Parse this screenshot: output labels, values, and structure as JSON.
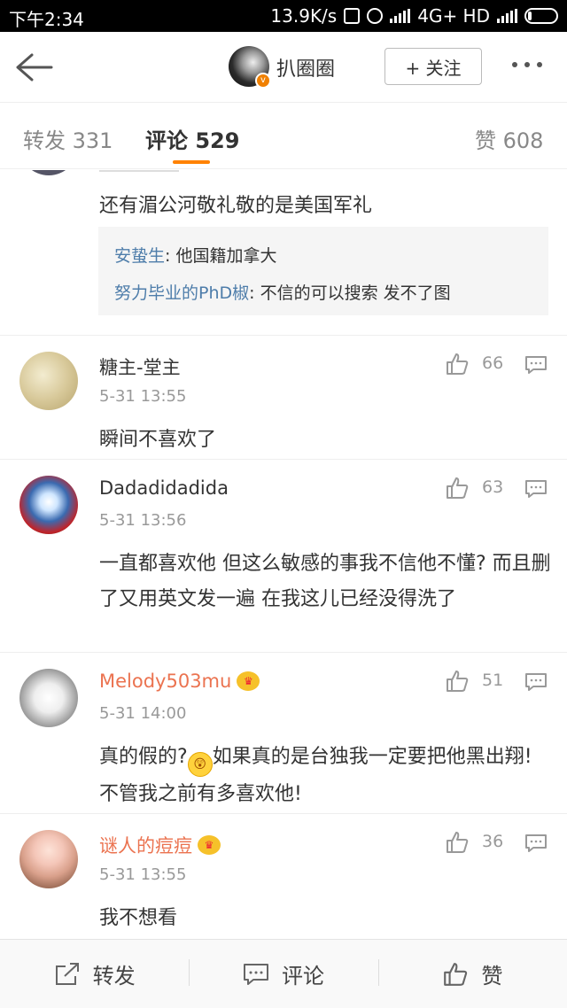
{
  "status_bar": {
    "time": "下午2:34",
    "net_speed": "13.9K/s",
    "network": "4G+ HD"
  },
  "header": {
    "name": "扒圈圈",
    "follow_label": "+ 关注"
  },
  "tabs": [
    {
      "label": "转发",
      "count": "331"
    },
    {
      "label": "评论",
      "count": "529"
    },
    {
      "label": "赞",
      "count": "608"
    }
  ],
  "top_comment": {
    "text": "还有湄公河敬礼敬的是美国军礼",
    "replies": [
      {
        "user": "安蛰生",
        "text": ": 他国籍加拿大"
      },
      {
        "user": "努力毕业的PhD椒",
        "text": ": 不信的可以搜索 发不了图"
      }
    ]
  },
  "comments": [
    {
      "name": "糖主-堂主",
      "date": "5-31 13:55",
      "likes": "66",
      "text": "瞬间不喜欢了",
      "vip": false
    },
    {
      "name": "Dadadidadida",
      "date": "5-31 13:56",
      "likes": "63",
      "text": "一直都喜欢他 但这么敏感的事我不信他不懂? 而且删了又用英文发一遍 在我这儿已经没得洗了",
      "vip": false
    },
    {
      "name": "Melody503mu",
      "date": "5-31 14:00",
      "likes": "51",
      "text_before": "真的假的?",
      "text_after": "如果真的是台独我一定要把他黑出翔! 不管我之前有多喜欢他!",
      "vip": true
    },
    {
      "name": "谜人的痘痘",
      "date": "5-31 13:55",
      "likes": "36",
      "text": "我不想看",
      "vip": true
    }
  ],
  "bottom_bar": {
    "repost": "转发",
    "comment": "评论",
    "like": "赞"
  },
  "colors": {
    "accent": "#ff8200",
    "link": "#4e7daa",
    "vip_name": "#eb7350"
  }
}
